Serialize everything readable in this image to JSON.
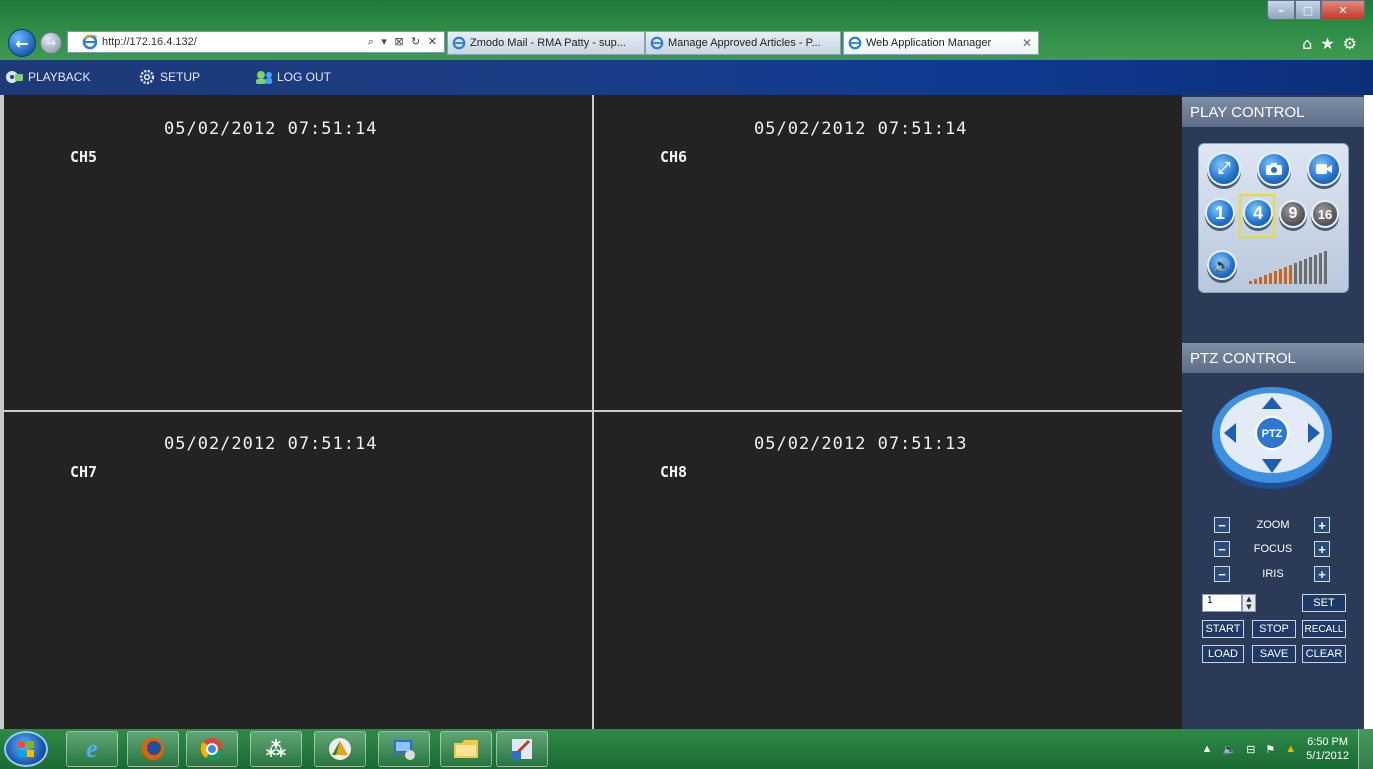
{
  "browser": {
    "url": "http://172.16.4.132/",
    "address_tools": "⌕ ▾ ⊠ ↻ ✕",
    "tabs": [
      {
        "title": "Zmodo Mail - RMA Patty - sup...",
        "active": false
      },
      {
        "title": "Manage Approved Articles - P...",
        "active": false
      },
      {
        "title": "Web Application Manager",
        "active": true
      }
    ],
    "tab_close": "✕",
    "window_controls": {
      "minimize": "–",
      "maximize": "□",
      "close": "✕"
    },
    "toolbar_icons": {
      "home": "⌂",
      "favorites": "★",
      "tools": "⚙"
    }
  },
  "app_toolbar": {
    "playback": "PLAYBACK",
    "setup": "SETUP",
    "logout": "LOG OUT"
  },
  "channels": [
    {
      "name": "CH5",
      "timestamp": "05/02/2012 07:51:14"
    },
    {
      "name": "CH6",
      "timestamp": "05/02/2012 07:51:14"
    },
    {
      "name": "CH7",
      "timestamp": "05/02/2012 07:51:14"
    },
    {
      "name": "CH8",
      "timestamp": "05/02/2012 07:51:13"
    }
  ],
  "play_control": {
    "title": "PLAY CONTROL",
    "layouts": [
      "1",
      "4",
      "9",
      "16"
    ],
    "selected_layout": "4",
    "volume_level": 0.55
  },
  "ptz_control": {
    "title": "PTZ CONTROL",
    "center_label": "PTZ",
    "zoom": "ZOOM",
    "focus": "FOCUS",
    "iris": "IRIS",
    "minus": "−",
    "plus": "+",
    "preset_value": "1",
    "buttons": {
      "set": "SET",
      "start": "START",
      "stop": "STOP",
      "recall": "RECALL",
      "load": "LOAD",
      "save": "SAVE",
      "clear": "CLEAR"
    }
  },
  "taskbar": {
    "time": "6:50 PM",
    "date": "5/1/2012"
  },
  "colors": {
    "video_bg": "#232323",
    "panel_bg": "#2b3a57",
    "toolbar_bg": "#1a3d86",
    "accent_selected": "#e8dc30"
  }
}
